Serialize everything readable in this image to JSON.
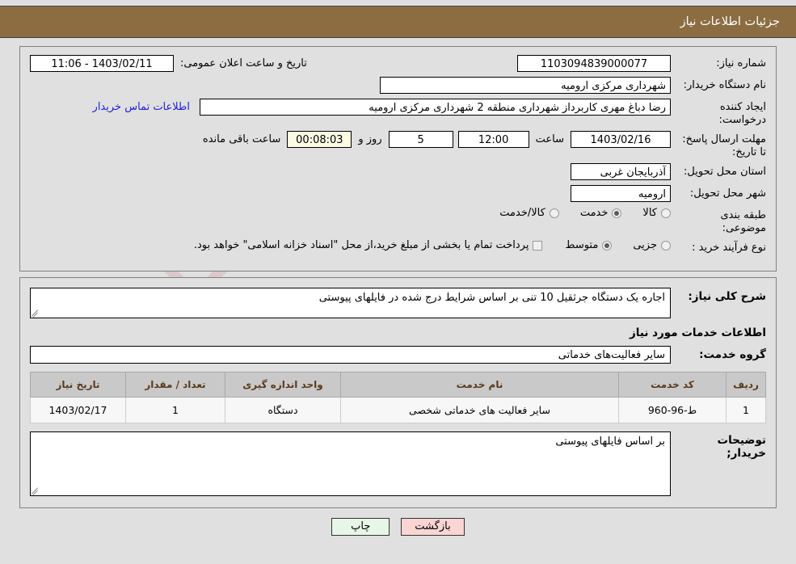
{
  "header": {
    "title": "جزئیات اطلاعات نیاز"
  },
  "top_panel": {
    "need_number": {
      "label": "شماره نیاز:",
      "value": "1103094839000077"
    },
    "announce": {
      "label": "تاریخ و ساعت اعلان عمومی:",
      "value": "11:06 - 1403/02/11"
    },
    "buyer_org": {
      "label": "نام دستگاه خریدار:",
      "value": "شهرداری مرکزی ارومیه"
    },
    "requester": {
      "label": "ایجاد کننده درخواست:",
      "value": "رضا دباغ مهری کاربرداز شهرداری منطقه 2 شهرداری مرکزی ارومیه",
      "contact_link": "اطلاعات تماس خریدار"
    },
    "deadline": {
      "label": "مهلت ارسال پاسخ: تا تاریخ:",
      "date": "1403/02/16",
      "time_label": "ساعت",
      "time": "12:00",
      "days": "5",
      "days_label": "روز و",
      "countdown": "00:08:03",
      "countdown_label": "ساعت باقی مانده"
    },
    "province": {
      "label": "استان محل تحویل:",
      "value": "آذربایجان غربی"
    },
    "city": {
      "label": "شهر محل تحویل:",
      "value": "ارومیه"
    },
    "category": {
      "label": "طبقه بندی موضوعی:",
      "options": [
        {
          "label": "کالا",
          "selected": false
        },
        {
          "label": "خدمت",
          "selected": true
        },
        {
          "label": "کالا/خدمت",
          "selected": false
        }
      ]
    },
    "purchase_type": {
      "label": "نوع فرآیند خرید :",
      "options": [
        {
          "label": "جزیی",
          "selected": false
        },
        {
          "label": "متوسط",
          "selected": true
        }
      ],
      "treasury_note": "پرداخت تمام یا بخشی از مبلغ خرید،از محل \"اسناد خزانه اسلامی\" خواهد بود.",
      "treasury_checked": false
    }
  },
  "mid_panel": {
    "general_desc": {
      "label": "شرح کلی نیاز:",
      "value": "اجاره یک دستگاه جرثقیل 10 تنی بر اساس شرایط درج شده در فایلهای پیوستی"
    },
    "services_heading": "اطلاعات خدمات مورد نیاز",
    "service_group": {
      "label": "گروه خدمت:",
      "value": "سایر فعالیت‌های خدماتی"
    },
    "table": {
      "columns": [
        "ردیف",
        "کد خدمت",
        "نام خدمت",
        "واحد اندازه گیری",
        "تعداد / مقدار",
        "تاریخ نیاز"
      ],
      "rows": [
        {
          "radif": "1",
          "code": "ط-96-960",
          "name": "سایر فعالیت های خدماتی شخصی",
          "unit": "دستگاه",
          "qty": "1",
          "date": "1403/02/17"
        }
      ]
    },
    "buyer_notes": {
      "label": "توضیحات خریدار;",
      "value": "بر اساس فایلهای پیوستی"
    }
  },
  "footer": {
    "print_label": "چاپ",
    "back_label": "بازگشت"
  },
  "watermark": {
    "text": "AriaTender.net"
  },
  "colors": {
    "header_bg": "#8b6d41",
    "page_bg": "#e0e0e0",
    "link": "#2020d8",
    "table_header_bg": "#c9c9c9",
    "table_header_text": "#5a3a1a",
    "print_btn": "#e8f6e8",
    "back_btn": "#fbd4d4",
    "countdown_bg": "#fbfbe4"
  }
}
